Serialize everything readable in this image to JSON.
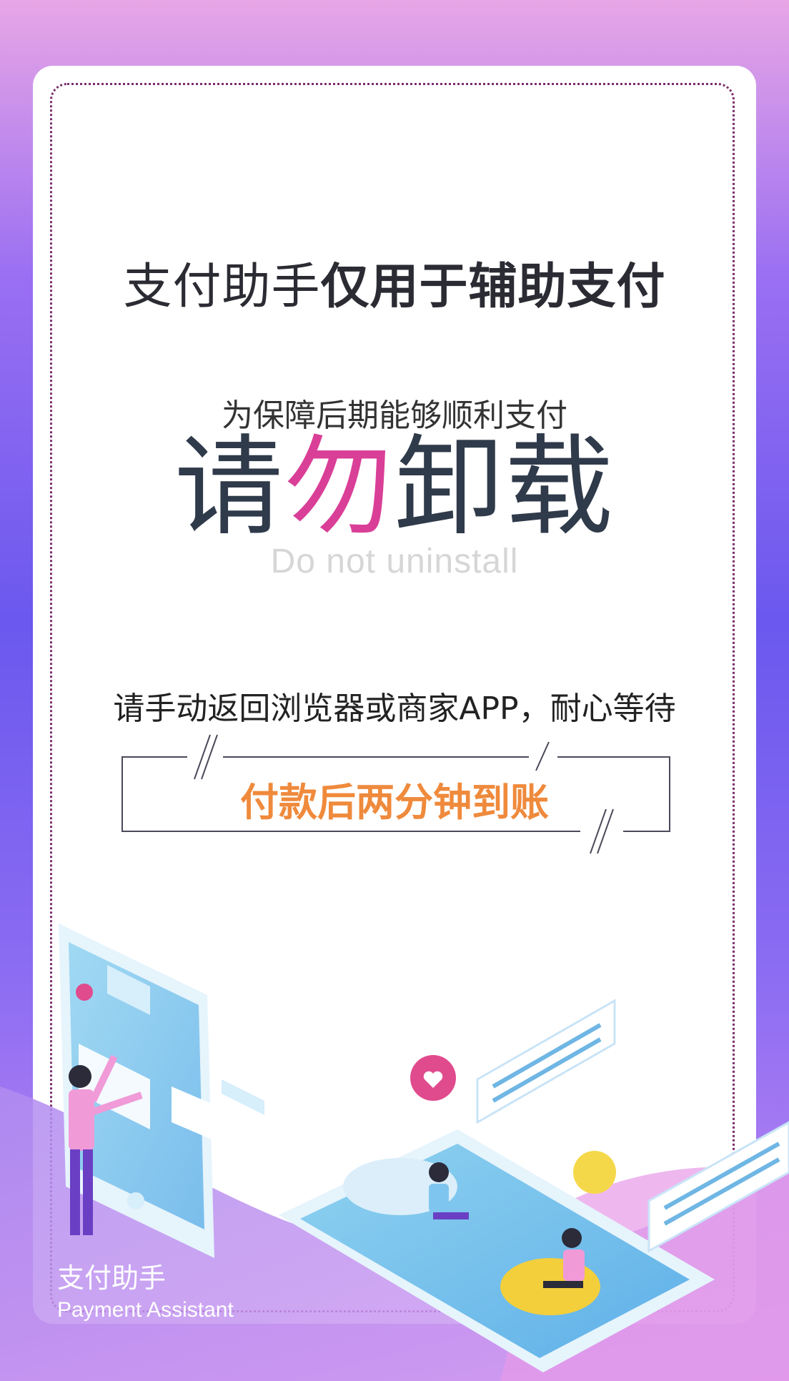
{
  "headline": {
    "regular": "支付助手",
    "bold": "仅用于辅助支付"
  },
  "subtitle": "为保障后期能够顺利支付",
  "big_title": {
    "part1": "请",
    "accent": "勿",
    "part2": "卸载"
  },
  "english_title": "Do not uninstall",
  "instruction": "请手动返回浏览器或商家APP，耐心等待",
  "highlight": "付款后两分钟到账",
  "brand": {
    "zh": "支付助手",
    "en": "Payment Assistant"
  },
  "colors": {
    "accent_pink": "#d93f97",
    "highlight_orange": "#ef8a3c",
    "dotted_border": "#7a2e6e",
    "title_dark": "#2f3a4a"
  }
}
